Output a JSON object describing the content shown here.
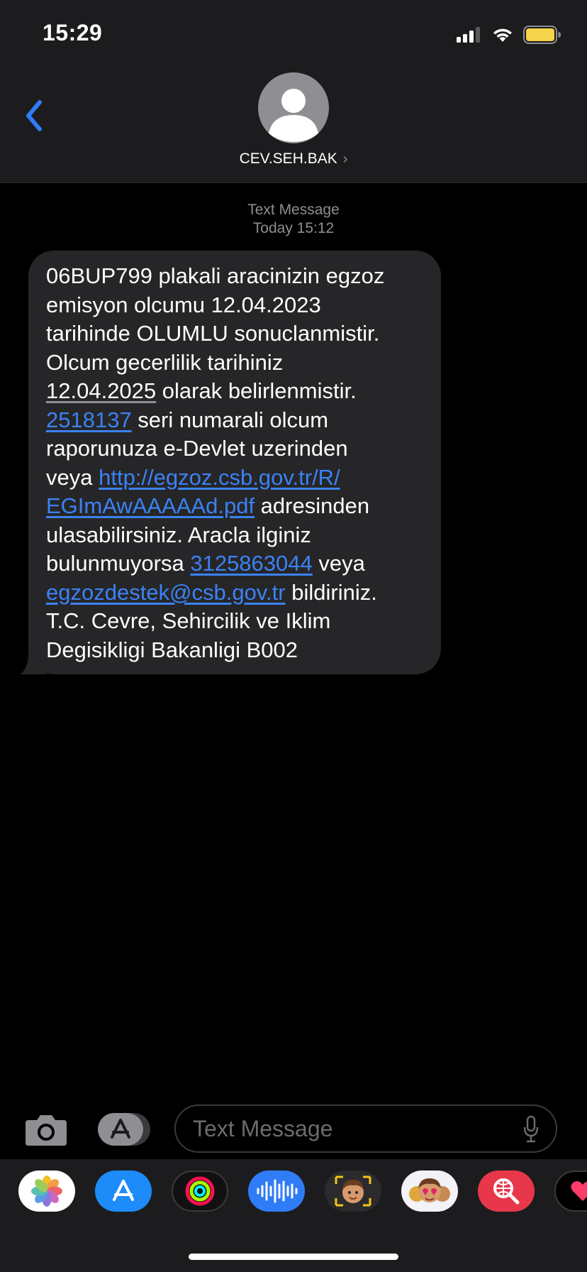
{
  "status": {
    "time": "15:29"
  },
  "header": {
    "contact_name": "CEV.SEH.BAK",
    "back_icon": "chevron-left-icon"
  },
  "thread": {
    "service": "Text Message",
    "timestamp": "Today 15:12"
  },
  "message": {
    "p01": "06BUP799 plakali aracinizin egzoz",
    "p02": "emisyon olcumu 12.04.2023",
    "p03": "tarihinde OLUMLU sonuclanmistir.",
    "p04": "Olcum gecerlilik tarihiniz",
    "p05_date": "12.04.2025",
    "p05_rest": " olarak belirlenmistir.",
    "p06_num": "2518137",
    "p06_rest": " seri numarali olcum",
    "p07": "raporunuza e-Devlet uzerinden",
    "p08_pre": "veya ",
    "link_part1": "http://egzoz.csb.gov.tr/R/",
    "link_part2": "EGImAwAAAAAd.pdf",
    "p09_rest": " adresinden",
    "p10": "ulasabilirsiniz. Aracla ilginiz",
    "p11_pre": "bulunmuyorsa ",
    "phone": "3125863044",
    "p11_rest": " veya",
    "email": "egzozdestek@csb.gov.tr",
    "p12_rest": " bildiriniz.",
    "p13": "T.C. Cevre, Sehircilik ve Iklim",
    "p14": "Degisikligi Bakanligi B002"
  },
  "composer": {
    "placeholder": "Text Message"
  },
  "colors": {
    "accent": "#3b82f6",
    "bubble": "#262628",
    "bar": "#1c1c1e",
    "battery": "#f5d34a"
  },
  "dock_apps": [
    "photos-icon",
    "app-store-icon",
    "activity-icon",
    "audio-message-icon",
    "memoji-icon",
    "memoji-stickers-icon",
    "image-search-icon",
    "digital-touch-icon"
  ]
}
